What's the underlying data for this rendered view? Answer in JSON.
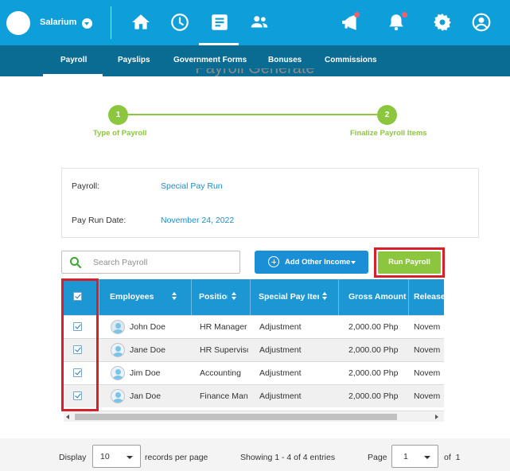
{
  "brand": {
    "name": "Salarium"
  },
  "topnav": {
    "icons": [
      "home-icon",
      "clock-icon",
      "document-icon",
      "people-icon",
      "megaphone-icon",
      "bell-icon",
      "gear-icon",
      "user-icon"
    ],
    "active": "document-icon",
    "accent": "#0e9fdb"
  },
  "subnav": {
    "items": [
      "Payroll",
      "Payslips",
      "Government Forms",
      "Bonuses",
      "Commissions"
    ],
    "active": "Payroll"
  },
  "page": {
    "title": "Payroll Generate"
  },
  "steps": [
    {
      "number": "1",
      "label": "Type of Payroll"
    },
    {
      "number": "2",
      "label": "Finalize Payroll Items"
    }
  ],
  "info": {
    "payroll_label": "Payroll:",
    "payroll_value": "Special Pay Run",
    "date_label": "Pay Run Date:",
    "date_value": "November 24, 2022"
  },
  "toolbar": {
    "search_placeholder": "Search Payroll",
    "add_income_label": "Add Other Income",
    "run_payroll_label": "Run Payroll"
  },
  "table": {
    "columns": [
      "Employees",
      "Position",
      "Special Pay Item",
      "Gross Amount",
      "Release"
    ],
    "rows": [
      {
        "checked": true,
        "name": "John Doe",
        "position": "HR Manager",
        "item": "Adjustment",
        "gross": "2,000.00 Php",
        "release": "Novem"
      },
      {
        "checked": true,
        "name": "Jane Doe",
        "position": "HR Supervisor",
        "item": "Adjustment",
        "gross": "2,000.00 Php",
        "release": "Novem"
      },
      {
        "checked": true,
        "name": "Jim Doe",
        "position": "Accounting",
        "item": "Adjustment",
        "gross": "2,000.00 Php",
        "release": "Novem"
      },
      {
        "checked": true,
        "name": "Jan Doe",
        "position": "Finance Manager",
        "item": "Adjustment",
        "gross": "2,000.00 Php",
        "release": "Novem"
      }
    ]
  },
  "footer": {
    "display_label": "Display",
    "per_page_value": "10",
    "per_page_suffix": "records per page",
    "showing_text": "Showing 1 - 4 of 4 entries",
    "page_label": "Page",
    "page_value": "1",
    "of_text": "of  1"
  },
  "colors": {
    "header_blue": "#0e9fdb",
    "subnav_blue": "#0a6c93",
    "green": "#8cc63f",
    "highlight_red": "#d8202a"
  }
}
